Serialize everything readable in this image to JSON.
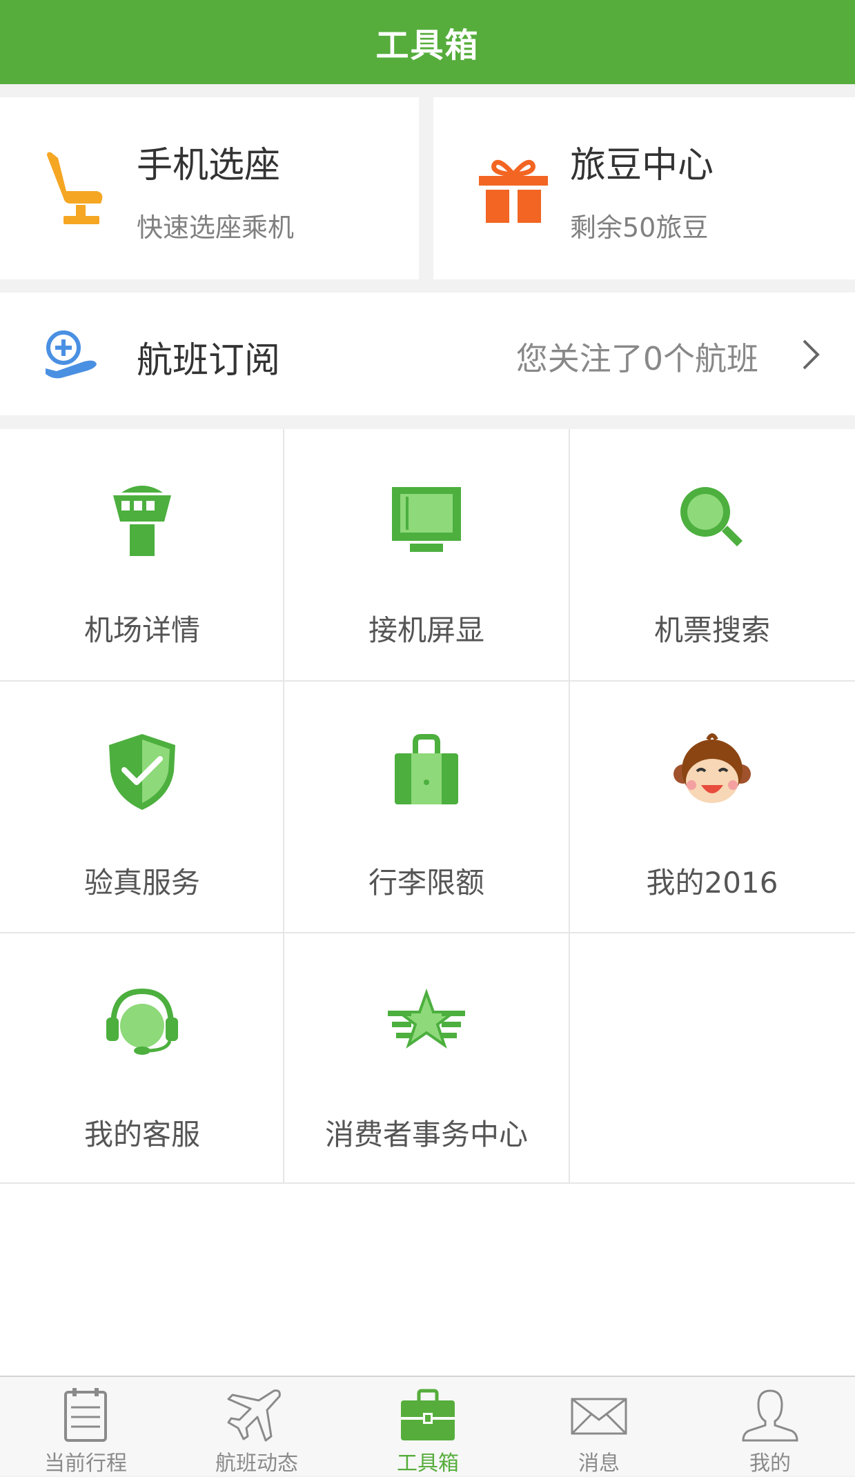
{
  "header": {
    "title": "工具箱"
  },
  "top_cards": [
    {
      "title": "手机选座",
      "subtitle": "快速选座乘机",
      "icon": "seat-icon",
      "color": "#f5a623"
    },
    {
      "title": "旅豆中心",
      "subtitle": "剩余50旅豆",
      "icon": "gift-icon",
      "color": "#f26522"
    }
  ],
  "subscription": {
    "title": "航班订阅",
    "note": "您关注了0个航班",
    "icon": "flight-subscribe-icon"
  },
  "tools": [
    {
      "label": "机场详情",
      "icon": "control-tower-icon"
    },
    {
      "label": "接机屏显",
      "icon": "display-screen-icon"
    },
    {
      "label": "机票搜索",
      "icon": "search-icon"
    },
    {
      "label": "验真服务",
      "icon": "shield-check-icon"
    },
    {
      "label": "行李限额",
      "icon": "luggage-icon"
    },
    {
      "label": "我的2016",
      "icon": "monkey-icon"
    },
    {
      "label": "我的客服",
      "icon": "headset-icon"
    },
    {
      "label": "消费者事务中心",
      "icon": "star-badge-icon"
    }
  ],
  "tabs": [
    {
      "label": "当前行程",
      "icon": "calendar-list-icon",
      "active": false
    },
    {
      "label": "航班动态",
      "icon": "airplane-icon",
      "active": false
    },
    {
      "label": "工具箱",
      "icon": "toolbox-icon",
      "active": true
    },
    {
      "label": "消息",
      "icon": "envelope-icon",
      "active": false
    },
    {
      "label": "我的",
      "icon": "user-icon",
      "active": false
    }
  ],
  "colors": {
    "brand_green": "#56ad3c",
    "icon_green": "#4caf3e",
    "light_green": "#8ed97a"
  }
}
